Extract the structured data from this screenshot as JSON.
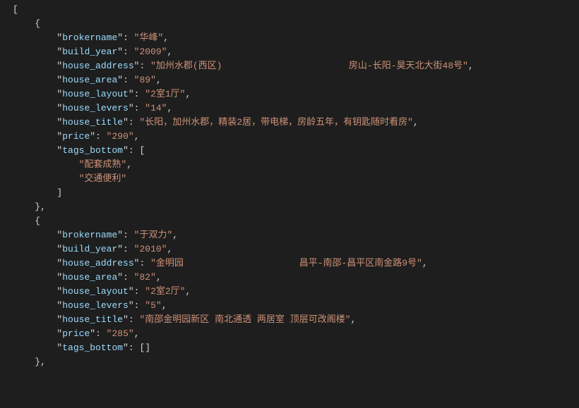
{
  "indent": "    ",
  "records": [
    {
      "brokername": "华峰",
      "build_year": "2009",
      "house_address": "加州水郡(西区)                       房山-长阳-昊天北大街48号",
      "house_area": "89",
      "house_layout": "2室1厅",
      "house_levers": "14",
      "house_title": "长阳，加州水郡，精装2居，带电梯，房龄五年，有钥匙随时看房",
      "price": "290",
      "tags_bottom": [
        "配套成熟",
        "交通便利"
      ]
    },
    {
      "brokername": "于双力",
      "build_year": "2010",
      "house_address": "金明园                     昌平-南邵-昌平区南金路9号",
      "house_area": "82",
      "house_layout": "2室2厅",
      "house_levers": "5",
      "house_title": "南邵金明园新区 南北通透 两居室 顶层可改阁楼",
      "price": "285",
      "tags_bottom": []
    }
  ],
  "key_order": [
    "brokername",
    "build_year",
    "house_address",
    "house_area",
    "house_layout",
    "house_levers",
    "house_title",
    "price",
    "tags_bottom"
  ]
}
